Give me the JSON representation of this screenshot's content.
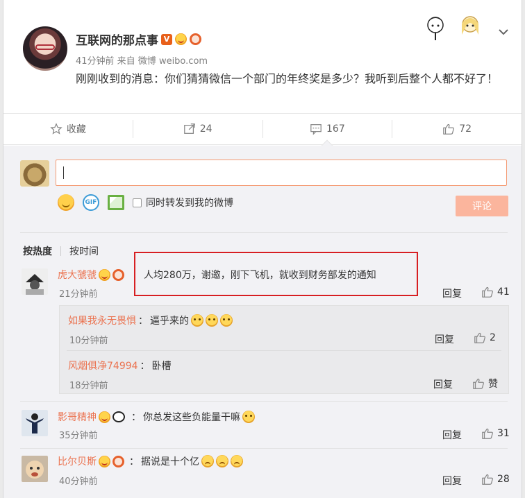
{
  "post": {
    "author": "互联网的那点事",
    "verified_badge": "V",
    "meta": "41分钟前 来自 微博 weibo.com",
    "text": "刚刚收到的消息：你们猜猜微信一个部门的年终奖是多少？我听到后整个人都不好了！"
  },
  "actions": {
    "favorite": "收藏",
    "repost": "24",
    "comment": "167",
    "like": "72"
  },
  "composer": {
    "forward_label": "同时转发到我的微博",
    "gif_label": "GIF",
    "submit": "评论"
  },
  "sort": {
    "by_hot": "按热度",
    "by_time": "按时间"
  },
  "comments": [
    {
      "user": "虎大虢虢",
      "text": "人均280万，谢邀，刚下飞机，就收到财务部发的通知",
      "time": "21分钟前",
      "reply": "回复",
      "likes": "41",
      "replies": [
        {
          "user": "如果我永无畏惧",
          "text": "逼乎来的",
          "time": "10分钟前",
          "reply": "回复",
          "likes": "2"
        },
        {
          "user": "风烟俱净74994",
          "text": "卧槽",
          "time": "18分钟前",
          "reply": "回复",
          "likes": "赞"
        }
      ]
    },
    {
      "user": "影哥精神",
      "text": "你总发这些负能量干嘛",
      "time": "35分钟前",
      "reply": "回复",
      "likes": "31"
    },
    {
      "user": "比尔贝斯",
      "text": "据说是十个亿",
      "time": "40分钟前",
      "reply": "回复",
      "likes": "28"
    }
  ],
  "colors": {
    "username": "#eb7350",
    "highlight": "#d71f22",
    "submit_disabled": "#fbb59d"
  }
}
